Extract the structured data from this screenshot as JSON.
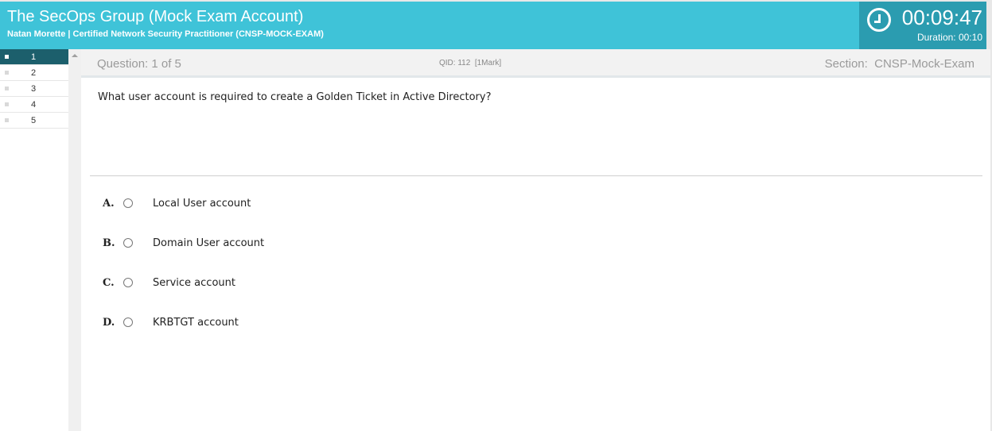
{
  "header": {
    "title": "The SecOps Group (Mock Exam Account)",
    "subtitle": "Natan Morette | Certified Network Security Practitioner (CNSP-MOCK-EXAM)",
    "timer": "00:09:47",
    "duration": "Duration: 00:10",
    "colors": {
      "header_bg": "#3fc3d8",
      "timer_bg": "#2b9cb0",
      "active_nav": "#1c5f6c"
    }
  },
  "nav": {
    "items": [
      {
        "label": "1",
        "state": "active"
      },
      {
        "label": "2",
        "state": "unvisited"
      },
      {
        "label": "3",
        "state": "unvisited"
      },
      {
        "label": "4",
        "state": "unvisited"
      },
      {
        "label": "5",
        "state": "unvisited"
      }
    ]
  },
  "question_bar": {
    "question_label": "Question: 1 of 5",
    "qid": "QID: 112  [1Mark]",
    "section": "Section:  CNSP-Mock-Exam"
  },
  "question": {
    "text": "What user account is required to create a Golden Ticket in Active Directory?",
    "options": [
      {
        "letter": "A.",
        "text": "Local User account"
      },
      {
        "letter": "B.",
        "text": "Domain User account"
      },
      {
        "letter": "C.",
        "text": "Service account"
      },
      {
        "letter": "D.",
        "text": "KRBTGT account"
      }
    ]
  }
}
